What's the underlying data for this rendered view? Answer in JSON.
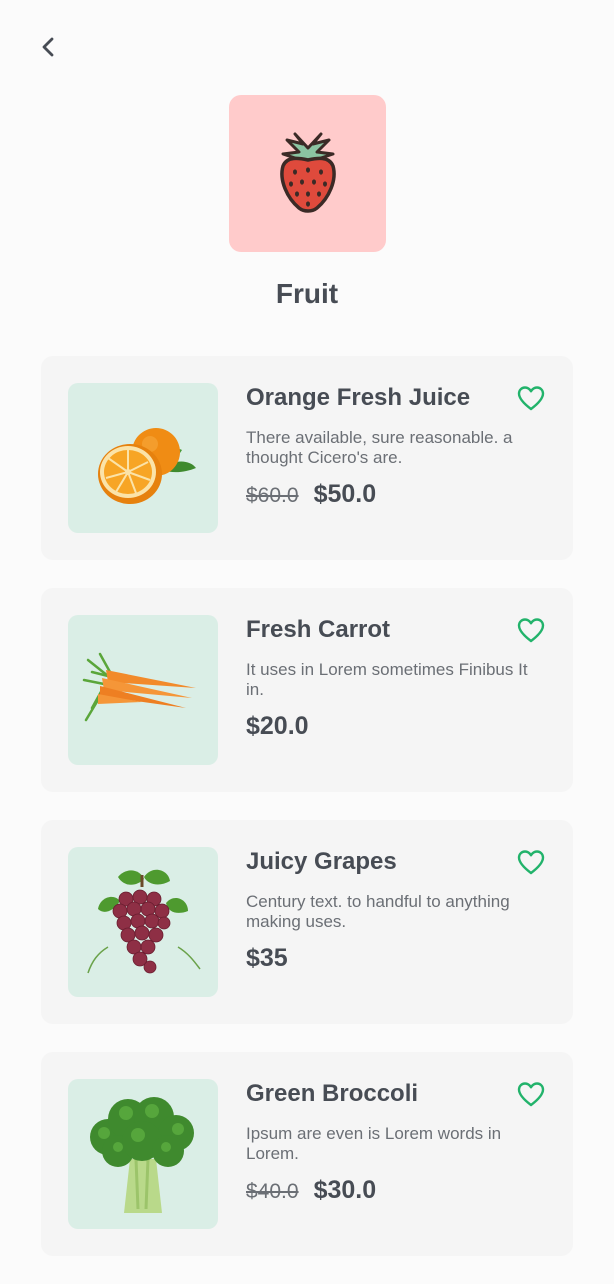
{
  "header": {
    "back_icon": "chevron-left-icon",
    "category_icon": "strawberry-icon",
    "category_bg": "#ffcbcb",
    "title": "Fruit"
  },
  "colors": {
    "accent": "#22b36b",
    "card_bg": "#f5f5f5",
    "thumb_bg": "#daeee6",
    "text": "#474c54"
  },
  "products": [
    {
      "name": "Orange Fresh Juice",
      "description": "There available, sure reasonable. a thought Cicero's are.",
      "old_price": "$60.0",
      "price": "$50.0",
      "image": "orange",
      "favorite_icon": "heart-outline-icon"
    },
    {
      "name": "Fresh Carrot",
      "description": "It uses in Lorem sometimes Finibus It in.",
      "old_price": "",
      "price": "$20.0",
      "image": "carrot",
      "favorite_icon": "heart-outline-icon"
    },
    {
      "name": "Juicy Grapes",
      "description": "Century text. to handful to anything making uses.",
      "old_price": "",
      "price": "$35",
      "image": "grapes",
      "favorite_icon": "heart-outline-icon"
    },
    {
      "name": "Green Broccoli",
      "description": "Ipsum are even is Lorem words in Lorem.",
      "old_price": "$40.0",
      "price": "$30.0",
      "image": "broccoli",
      "favorite_icon": "heart-outline-icon"
    }
  ]
}
